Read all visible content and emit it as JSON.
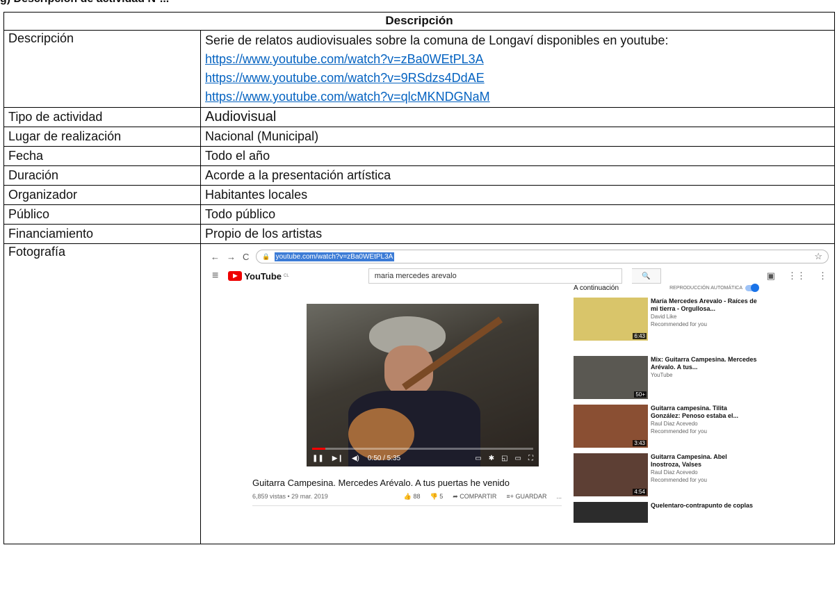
{
  "cutoff_heading": "g) Descripción de actividad Nº...",
  "table": {
    "header": "Descripción",
    "description": {
      "label": "Descripción",
      "text": "Serie de relatos audiovisuales sobre la comuna de Longaví disponibles en youtube:",
      "links": [
        "https://www.youtube.com/watch?v=zBa0WEtPL3A",
        "https://www.youtube.com/watch?v=9RSdzs4DdAE",
        "https://www.youtube.com/watch?v=qlcMKNDGNaM"
      ]
    },
    "rows": [
      {
        "label": "Tipo de actividad",
        "value": "Audiovisual"
      },
      {
        "label": "Lugar de realización",
        "value": "Nacional (Municipal)"
      },
      {
        "label": "Fecha",
        "value": "Todo el año"
      },
      {
        "label": "Duración",
        "value": "Acorde a la presentación artística"
      },
      {
        "label": "Organizador",
        "value": "Habitantes locales"
      },
      {
        "label": "Público",
        "value": "Todo público"
      },
      {
        "label": "Financiamiento",
        "value": "Propio de los artistas"
      }
    ],
    "photo_label": "Fotografía"
  },
  "screenshot": {
    "nav": {
      "back": "←",
      "forward": "→",
      "reload": "C",
      "lock": "🔒",
      "url": "youtube.com/watch?v=zBa0WEtPL3A",
      "star": "☆"
    },
    "youtube": {
      "menu": "≡",
      "logo_text": "YouTube",
      "logo_cl": "CL",
      "search_value": "maria mercedes arevalo",
      "search_icon": "🔍",
      "header_icons": [
        "▣",
        "⋮⋮",
        "⋮"
      ]
    },
    "player": {
      "time": "0:50 / 5:35",
      "progress": 0.06
    },
    "video": {
      "title": "Guitarra Campesina. Mercedes Arévalo. A tus puertas he venido",
      "meta": "6,859 vistas • 29 mar. 2019",
      "likes": "88",
      "dislikes": "5",
      "share": "COMPARTIR",
      "save": "GUARDAR",
      "more": "..."
    },
    "sidebar": {
      "up_next": "A continuación",
      "autoplay": "REPRODUCCIÓN AUTOMÁTICA",
      "items": [
        {
          "title": "María Mercedes Arevalo - Raíces de mi tierra - Orgullosa...",
          "channel": "David Like",
          "note": "Recommended for you",
          "duration": "6:43",
          "color": "#d9c56a"
        },
        {
          "title": "Mix: Guitarra Campesina. Mercedes Arévalo. A tus...",
          "channel": "YouTube",
          "note": "",
          "duration": "50+",
          "color": "#5a5852"
        },
        {
          "title": "Guitarra campesina. Tilita González: Penoso estaba el...",
          "channel": "Raul Diaz Acevedo",
          "note": "Recommended for you",
          "duration": "3:43",
          "color": "#8a4f33"
        },
        {
          "title": "Guitarra Campesina. Abel Inostroza, Valses",
          "channel": "Raul Diaz Acevedo",
          "note": "Recommended for you",
          "duration": "4:54",
          "color": "#5d3f34"
        },
        {
          "title": "Quelentaro-contrapunto de coplas",
          "channel": "",
          "note": "",
          "duration": "",
          "color": "#2c2c2c"
        }
      ]
    }
  }
}
